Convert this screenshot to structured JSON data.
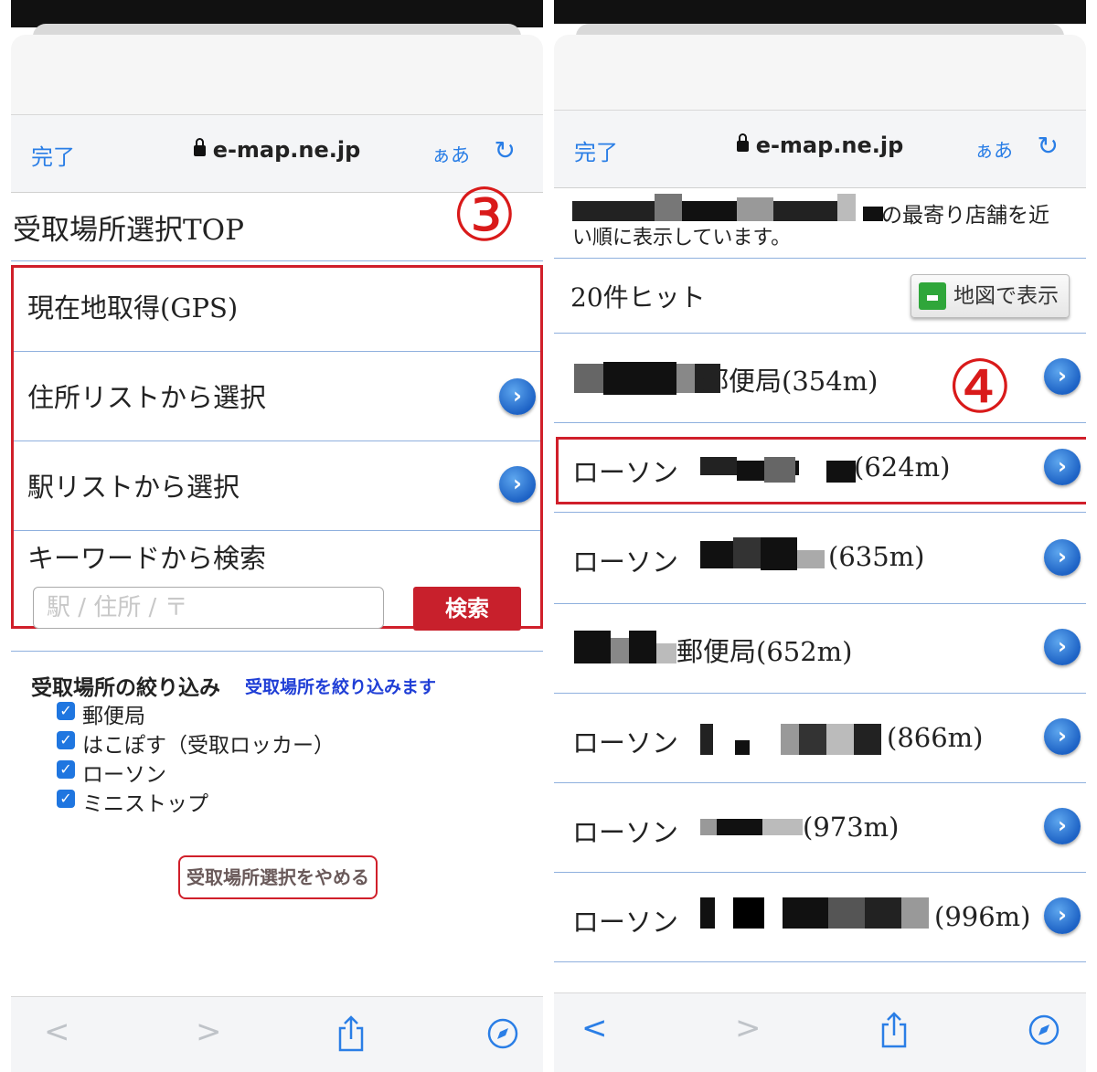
{
  "left": {
    "browser": {
      "done": "完了",
      "url": "e-map.ne.jp",
      "text_size": "ぁあ"
    },
    "page_title": "受取場所選択TOP",
    "step_badge": "③",
    "menu": [
      {
        "label": "現在地取得(GPS)"
      },
      {
        "label": "住所リストから選択"
      },
      {
        "label": "駅リストから選択"
      },
      {
        "label": "キーワードから検索"
      }
    ],
    "search": {
      "placeholder": "駅 / 住所 / 〒",
      "button": "検索"
    },
    "filter": {
      "title": "受取場所の絞り込み",
      "link": "受取場所を絞り込みます",
      "options": [
        {
          "label": "郵便局",
          "checked": true
        },
        {
          "label": "はこぽす（受取ロッカー）",
          "checked": true
        },
        {
          "label": "ローソン",
          "checked": true
        },
        {
          "label": "ミニストップ",
          "checked": true
        }
      ]
    },
    "cancel_button": "受取場所選択をやめる"
  },
  "right": {
    "browser": {
      "done": "完了",
      "url": "e-map.ne.jp",
      "text_size": "ぁあ"
    },
    "intro_tail": "の最寄り店舗を近",
    "intro_line2": "い順に表示しています。",
    "hit_count": "20件ヒット",
    "map_button": "地図で表示",
    "step_badge": "④",
    "results": [
      {
        "name": "郵便局(354m)"
      },
      {
        "name": "ローソン",
        "dist": "(624m)"
      },
      {
        "name": "ローソン",
        "dist": "(635m)"
      },
      {
        "name": "郵便局(652m)"
      },
      {
        "name": "ローソン",
        "dist": "(866m)"
      },
      {
        "name": "ローソン",
        "dist": "(973m)"
      },
      {
        "name": "ローソン",
        "dist": "(996m)"
      }
    ]
  },
  "icons": {
    "back": "chevron-left-icon",
    "forward": "chevron-right-icon",
    "share": "share-icon",
    "compass": "compass-icon",
    "reload": "reload-icon",
    "lock": "lock-icon"
  },
  "colors": {
    "accent": "#2a7ee6",
    "highlight": "#d01f2a",
    "badge": "#d91a1a",
    "search_button": "#c8202c"
  }
}
